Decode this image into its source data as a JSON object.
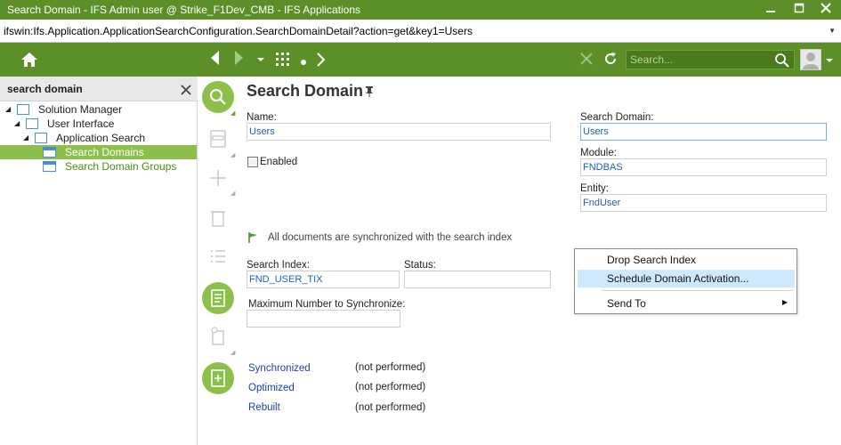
{
  "window": {
    "title": "Search Domain - IFS Admin user @ Strike_F1Dev_CMB - IFS Applications"
  },
  "address": {
    "url": "ifswin:Ifs.Application.ApplicationSearchConfiguration.SearchDomainDetail?action=get&key1=Users"
  },
  "toolbar": {
    "search_placeholder": "Search..."
  },
  "sidebar": {
    "header": "search domain",
    "tree": [
      {
        "label": "Solution Manager"
      },
      {
        "label": "User Interface"
      },
      {
        "label": "Application Search"
      },
      {
        "label": "Search Domains"
      },
      {
        "label": "Search Domain Groups"
      }
    ]
  },
  "page": {
    "title": "Search Domain"
  },
  "form": {
    "name_label": "Name:",
    "name_value": "Users",
    "enabled_label": "Enabled",
    "search_domain_label": "Search Domain:",
    "search_domain_value": "Users",
    "module_label": "Module:",
    "module_value": "FNDBAS",
    "entity_label": "Entity:",
    "entity_value": "FndUser",
    "sync_message": "All documents are synchronized with the search index",
    "search_index_label": "Search Index:",
    "search_index_value": "FND_USER_TIX",
    "status_label": "Status:",
    "status_value": "",
    "max_sync_label": "Maximum Number to Synchronize:",
    "max_sync_value": ""
  },
  "stats": [
    {
      "label": "Synchronized",
      "value": "(not performed)"
    },
    {
      "label": "Optimized",
      "value": "(not performed)"
    },
    {
      "label": "Rebuilt",
      "value": "(not performed)"
    }
  ],
  "context_menu": {
    "items": [
      {
        "label": "Drop Search Index"
      },
      {
        "label": "Schedule Domain Activation..."
      },
      {
        "label": "Send To"
      }
    ]
  },
  "colors": {
    "brand": "#5d8f29",
    "accent": "#8dc04b",
    "link": "#2040a8",
    "menu_highlight": "#cde8ff"
  }
}
